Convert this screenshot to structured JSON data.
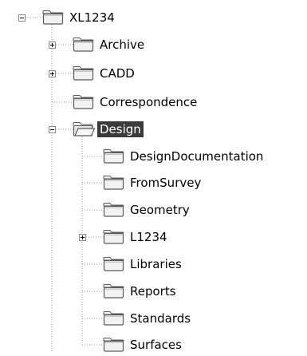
{
  "tree": {
    "root": {
      "label": "XL1234",
      "icon": "folder-icon",
      "state": "expanded"
    },
    "nodes": [
      {
        "label": "Archive",
        "icon": "folder-icon",
        "state": "collapsed"
      },
      {
        "label": "CADD",
        "icon": "folder-icon",
        "state": "collapsed"
      },
      {
        "label": "Correspondence",
        "icon": "folder-icon",
        "state": "leaf"
      },
      {
        "label": "Design",
        "icon": "folder-open-icon",
        "state": "expanded",
        "selected": true
      },
      {
        "label": "DesignDocumentation",
        "icon": "folder-icon",
        "state": "leaf"
      },
      {
        "label": "FromSurvey",
        "icon": "folder-icon",
        "state": "leaf"
      },
      {
        "label": "Geometry",
        "icon": "folder-icon",
        "state": "leaf"
      },
      {
        "label": "L1234",
        "icon": "folder-icon",
        "state": "collapsed"
      },
      {
        "label": "Libraries",
        "icon": "folder-icon",
        "state": "leaf"
      },
      {
        "label": "Reports",
        "icon": "folder-icon",
        "state": "leaf"
      },
      {
        "label": "Standards",
        "icon": "folder-icon",
        "state": "leaf"
      },
      {
        "label": "Surfaces",
        "icon": "folder-icon",
        "state": "leaf"
      }
    ]
  },
  "colors": {
    "selection_background": "#3a3a3a",
    "selection_text": "#ffffff",
    "guide_line": "#9a9a9a",
    "folder_outline": "#5a5a5a",
    "folder_fill": "#f2f2f2"
  }
}
